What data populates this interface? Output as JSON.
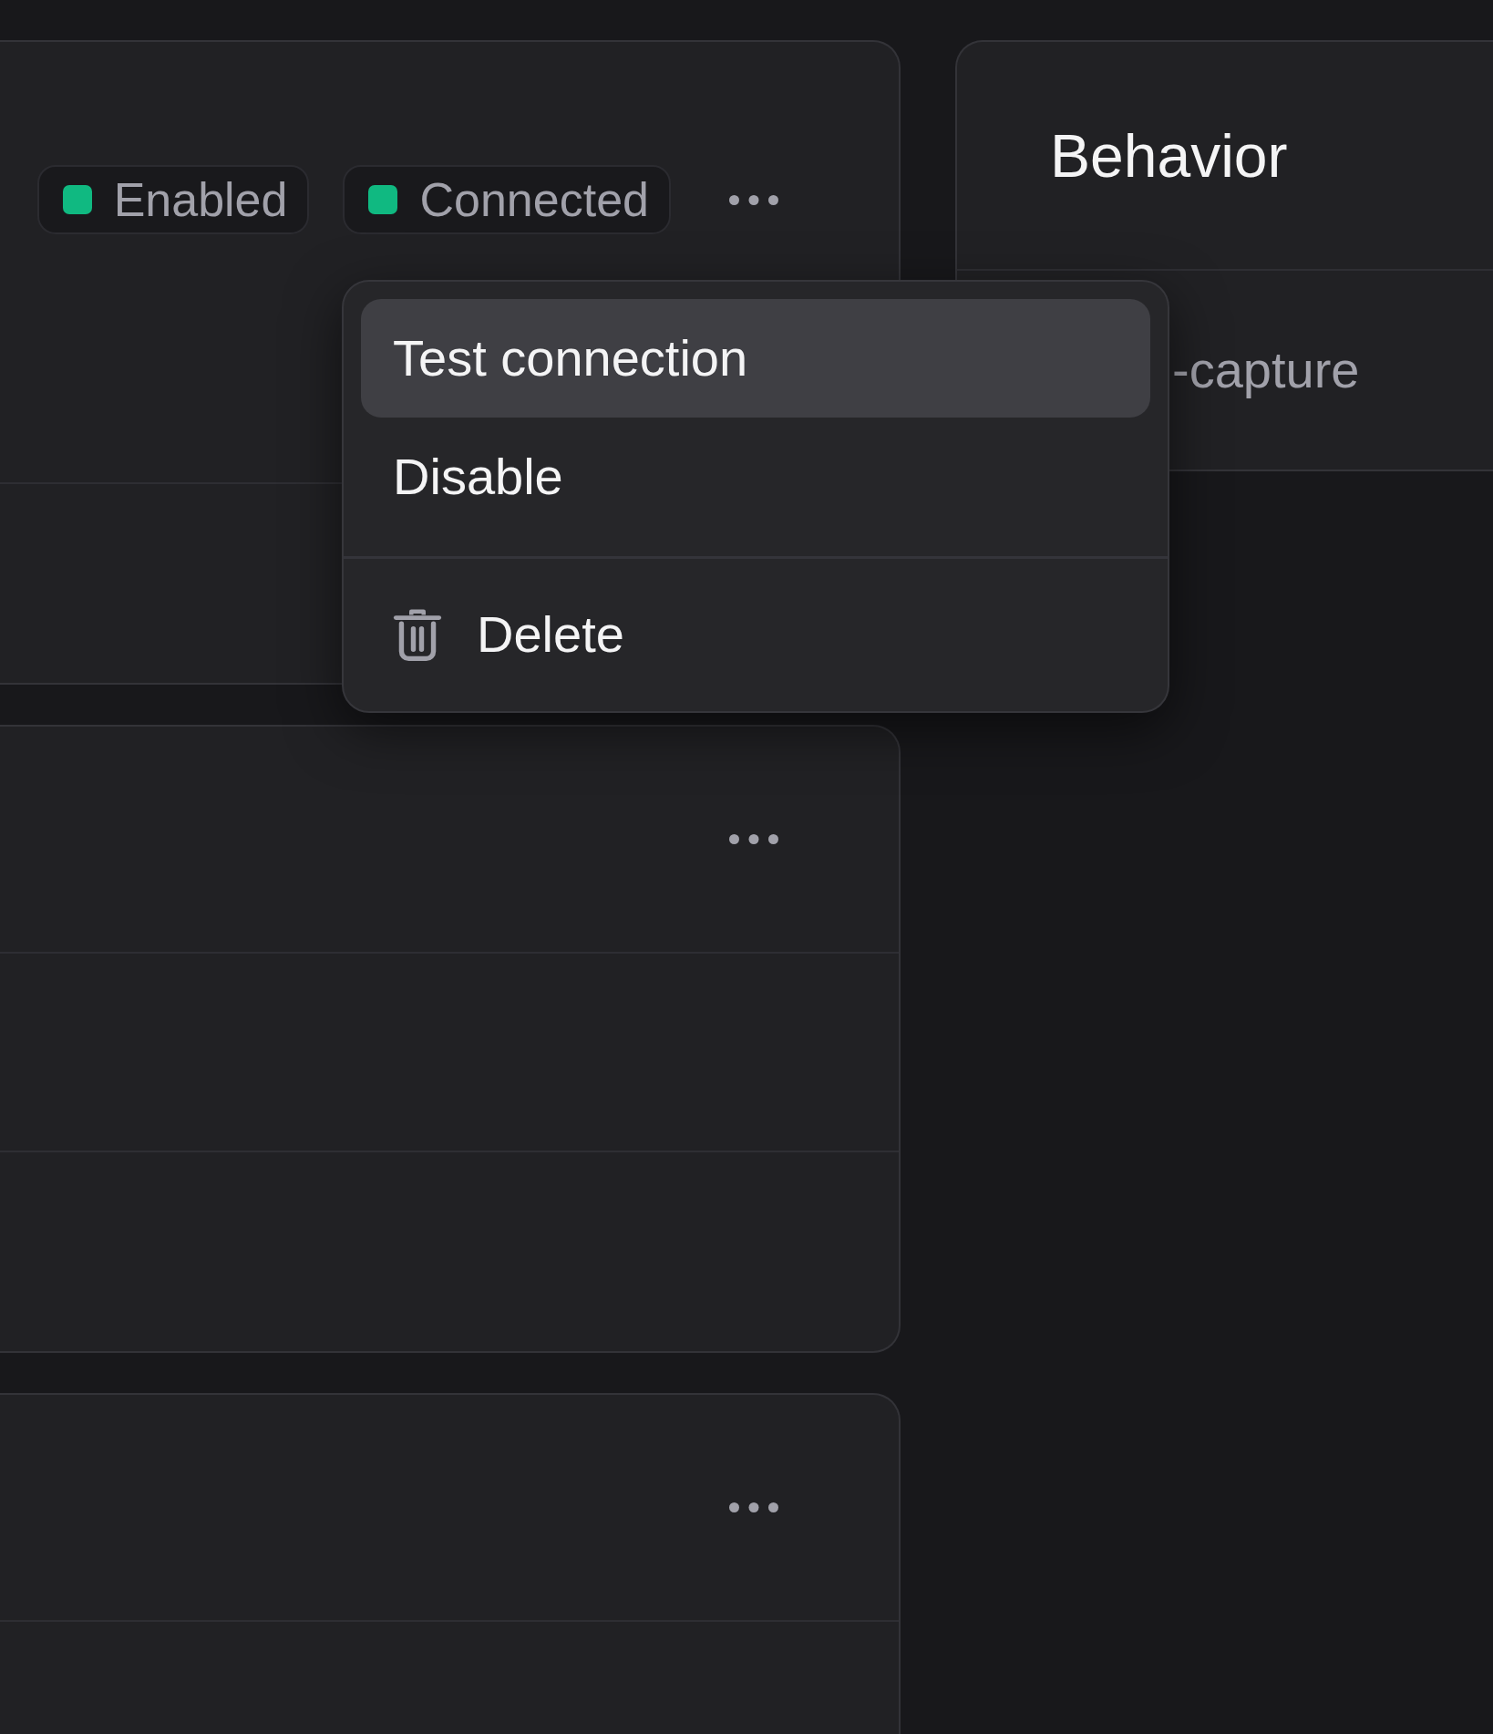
{
  "cards": [
    {
      "kind": "expanded",
      "badges": [
        {
          "label": "Enabled",
          "color": "#10b981"
        },
        {
          "label": "Connected",
          "color": "#10b981"
        }
      ]
    },
    {
      "kind": "compact"
    },
    {
      "kind": "compact"
    }
  ],
  "behavior_panel": {
    "title": "Behavior",
    "rows": [
      "-capture"
    ]
  },
  "menu": {
    "groups": [
      [
        {
          "label": "Test connection",
          "kind": "plain",
          "selected": true
        },
        {
          "label": "Disable",
          "kind": "plain",
          "selected": false
        }
      ],
      [
        {
          "label": "Delete",
          "kind": "destructive",
          "selected": false
        }
      ]
    ]
  }
}
